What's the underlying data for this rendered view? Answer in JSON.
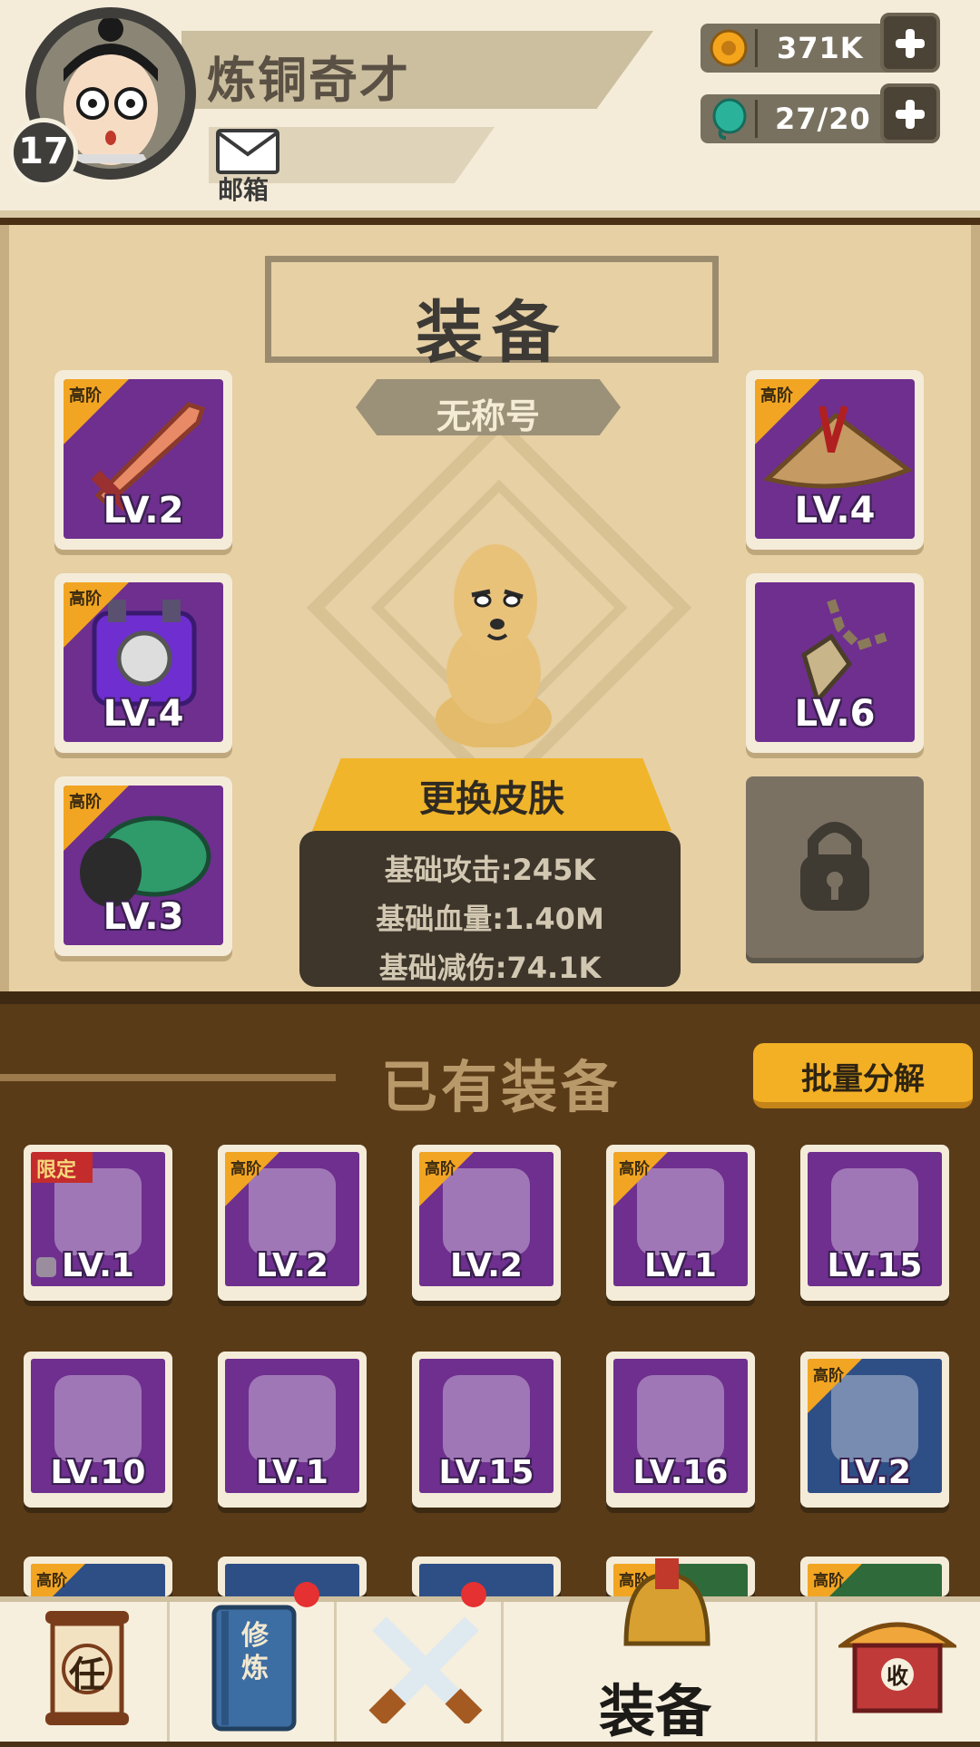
{
  "player": {
    "name": "炼铜奇才",
    "level": "17",
    "mail_label": "邮箱"
  },
  "resources": {
    "coins": "371K",
    "gems": "27/20"
  },
  "equip_panel": {
    "title": "装备",
    "subtitle": "无称号",
    "slots": [
      {
        "tier": "高阶",
        "level": "LV.2",
        "icon": "sword-icon"
      },
      {
        "tier": "高阶",
        "level": "LV.4",
        "icon": "armor-icon"
      },
      {
        "tier": "高阶",
        "level": "LV.3",
        "icon": "gauntlet-icon"
      },
      {
        "tier": "高阶",
        "level": "LV.4",
        "icon": "straw-hat-icon"
      },
      {
        "tier": "",
        "level": "LV.6",
        "icon": "necklace-icon"
      }
    ],
    "skin_button": "更换皮肤",
    "stats": [
      "基础攻击:245K",
      "基础血量:1.40M",
      "基础减伤:74.1K"
    ]
  },
  "inventory": {
    "title": "已有装备",
    "batch_button": "批量分解",
    "items": [
      {
        "tag": "限定",
        "level": "LV.1",
        "icon": "chinese-knot-icon",
        "bg": "#6e2f8f"
      },
      {
        "tag": "高阶",
        "level": "LV.2",
        "icon": "red-claw-icon",
        "bg": "#6e2f8f"
      },
      {
        "tag": "高阶",
        "level": "LV.2",
        "icon": "machete-icon",
        "bg": "#6e2f8f"
      },
      {
        "tag": "高阶",
        "level": "LV.1",
        "icon": "machete-icon",
        "bg": "#6e2f8f"
      },
      {
        "tag": "",
        "level": "LV.15",
        "icon": "cleaver-icon",
        "bg": "#6e2f8f"
      },
      {
        "tag": "",
        "level": "LV.10",
        "icon": "gold-claw-icon",
        "bg": "#6e2f8f"
      },
      {
        "tag": "",
        "level": "LV.1",
        "icon": "sword-icon",
        "bg": "#6e2f8f"
      },
      {
        "tag": "",
        "level": "LV.15",
        "icon": "straw-hat-icon",
        "bg": "#6e2f8f"
      },
      {
        "tag": "",
        "level": "LV.16",
        "icon": "armor-icon",
        "bg": "#6e2f8f"
      },
      {
        "tag": "高阶",
        "level": "LV.2",
        "icon": "cleaver-icon",
        "bg": "#2e4f86"
      }
    ],
    "partial_row_tags": [
      "高阶",
      "",
      "",
      "高阶",
      "高阶"
    ]
  },
  "nav": {
    "items": [
      {
        "label": "任",
        "icon": "task-scroll-icon"
      },
      {
        "label": "修炼",
        "icon": "cultivation-book-icon"
      },
      {
        "label": "",
        "icon": "crossed-swords-icon"
      },
      {
        "label": "装备",
        "icon": "helmet-icon"
      },
      {
        "label": "收",
        "icon": "shop-icon"
      }
    ]
  },
  "colors": {
    "tier_gold": "#f2a522",
    "item_purple": "#6e2f8f",
    "item_blue": "#2e4f86",
    "panel": "#e6d0a4",
    "inventory_bg": "#5a3b18"
  }
}
